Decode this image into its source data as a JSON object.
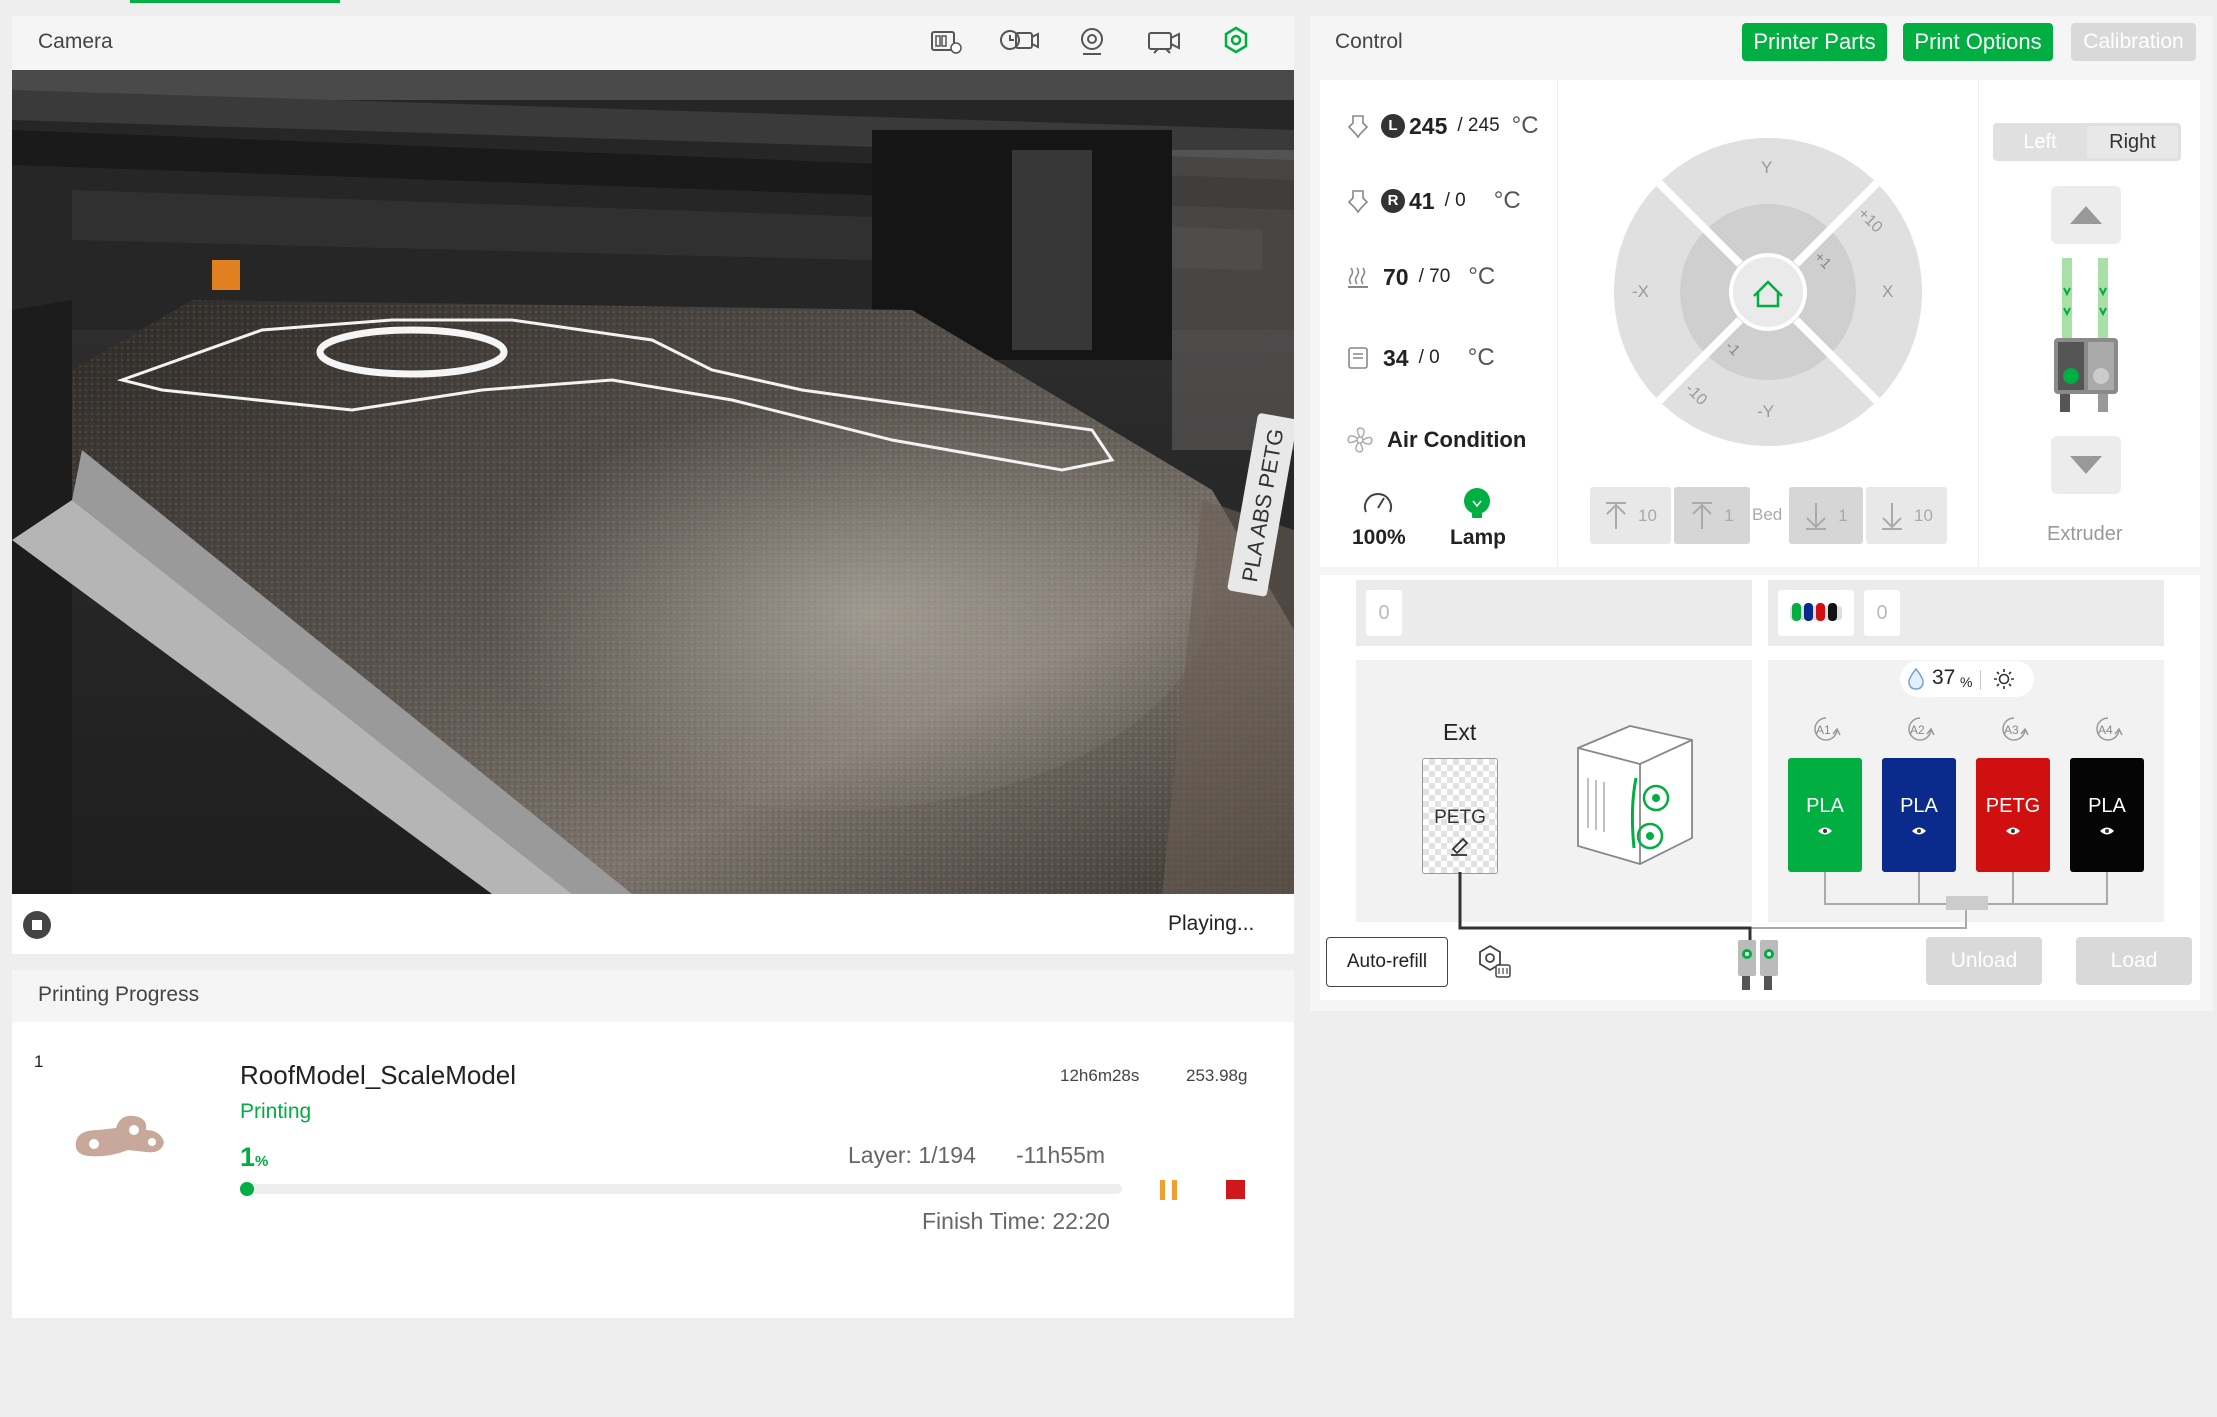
{
  "camera": {
    "title": "Camera",
    "status": "Playing...",
    "icons": [
      "sd-card-icon",
      "timelapse-icon",
      "webcam-icon",
      "recording-icon",
      "camera-settings-icon"
    ],
    "overlay_text": [
      "PLA",
      "ABS",
      "PETG"
    ]
  },
  "control": {
    "title": "Control",
    "tabs": {
      "printer_parts": "Printer Parts",
      "print_options": "Print Options",
      "calibration": "Calibration"
    },
    "nozzle_left": {
      "badge": "L",
      "current": "245",
      "target": "/ 245",
      "unit": "°C"
    },
    "nozzle_right": {
      "badge": "R",
      "current": "41",
      "target": "/ 0",
      "unit": "°C"
    },
    "bed": {
      "current": "70",
      "target": "/ 70",
      "unit": "°C"
    },
    "chamber": {
      "current": "34",
      "target": "/ 0",
      "unit": "°C"
    },
    "air_condition": "Air Condition",
    "speed": "100%",
    "lamp": "Lamp",
    "jog": {
      "y": "Y",
      "minus_y": "-Y",
      "x": "X",
      "minus_x": "-X",
      "p10": "+10",
      "p1": "+1",
      "m1": "-1",
      "m10": "-10"
    },
    "bed_controls": {
      "up10": "10",
      "up1": "1",
      "label": "Bed",
      "down1": "1",
      "down10": "10"
    },
    "extruder": {
      "left": "Left",
      "right": "Right",
      "label": "Extruder"
    }
  },
  "ams": {
    "ext_slot_count": "0",
    "ams_slot_count": "0",
    "humidity": "37",
    "humidity_unit": "%",
    "ext_label": "Ext",
    "ext_filament": "PETG",
    "slots": [
      {
        "id": "A1",
        "type": "PLA",
        "color": "#00ae42"
      },
      {
        "id": "A2",
        "type": "PLA",
        "color": "#0a2a8c"
      },
      {
        "id": "A3",
        "type": "PETG",
        "color": "#d01010"
      },
      {
        "id": "A4",
        "type": "PLA",
        "color": "#050505"
      }
    ],
    "auto_refill": "Auto-refill",
    "unload": "Unload",
    "load": "Load"
  },
  "progress": {
    "title": "Printing Progress",
    "index": "1",
    "model_name": "RoofModel_ScaleModel",
    "duration": "12h6m28s",
    "weight": "253.98g",
    "status": "Printing",
    "percent": "1",
    "percent_unit": "%",
    "percent_fraction": 0.01,
    "layer": "Layer: 1/194",
    "remaining": "-11h55m",
    "finish_time": "Finish Time: 22:20"
  }
}
